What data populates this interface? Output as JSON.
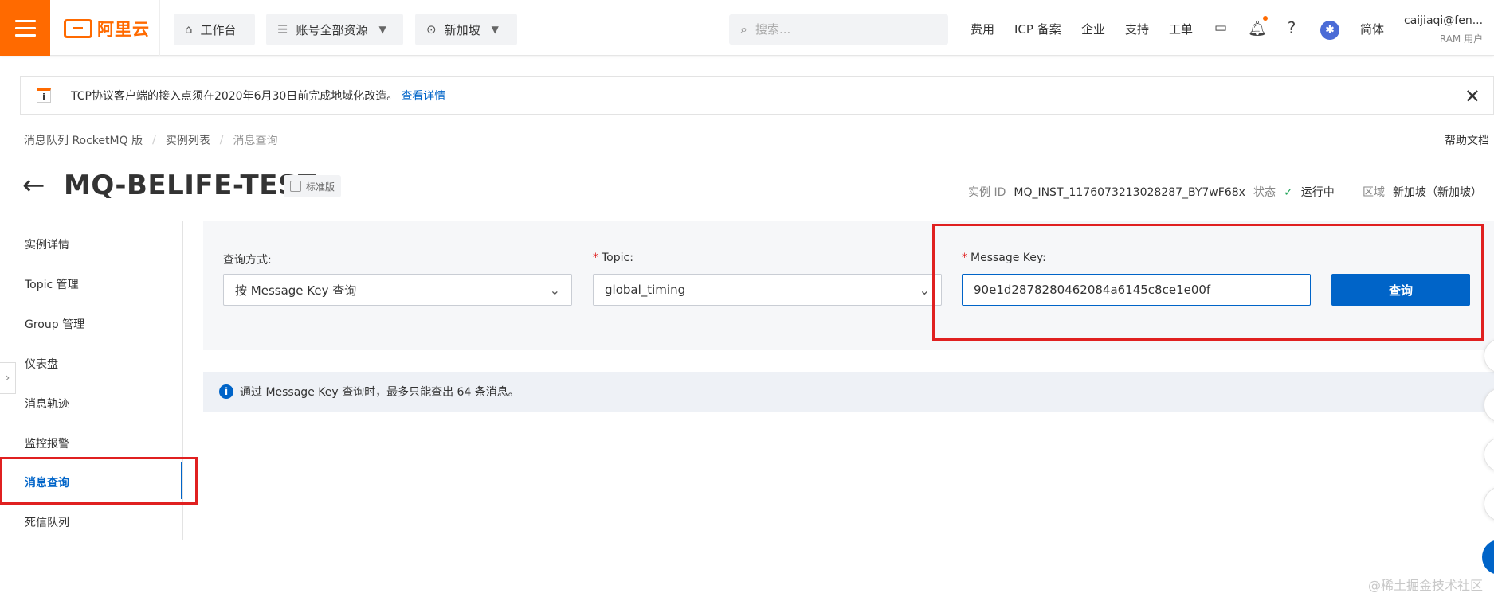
{
  "topbar": {
    "logo_text": "阿里云",
    "workbench": "工作台",
    "resources": "账号全部资源",
    "region": "新加坡",
    "search_placeholder": "搜索...",
    "links": {
      "fees": "费用",
      "icp": "ICP 备案",
      "enterprise": "企业",
      "support": "支持",
      "ticket": "工单",
      "lang": "简体"
    },
    "user": {
      "name": "caijiaqi@fen...",
      "role": "RAM 用户"
    }
  },
  "notice": {
    "icon_letter": "i",
    "text": "TCP协议客户端的接入点须在2020年6月30日前完成地域化改造。",
    "link": "查看详情"
  },
  "breadcrumb": [
    "消息队列 RocketMQ 版",
    "实例列表",
    "消息查询"
  ],
  "help_link": "帮助文档",
  "instance": {
    "name": "MQ-BELIFE-TEST",
    "edition": "标准版",
    "id_label": "实例 ID",
    "id_value": "MQ_INST_1176073213028287_BY7wF68x",
    "status_label": "状态",
    "status_value": "运行中",
    "region_label": "区域",
    "region_value": "新加坡（新加坡）"
  },
  "sidenav": {
    "items": [
      "实例详情",
      "Topic 管理",
      "Group 管理",
      "仪表盘",
      "消息轨迹",
      "监控报警",
      "消息查询",
      "死信队列"
    ],
    "active": "消息查询"
  },
  "query": {
    "method_label": "查询方式:",
    "method_value": "按 Message Key 查询",
    "topic_label": "Topic:",
    "topic_value": "global_timing",
    "key_label": "Message Key:",
    "key_value": "90e1d2878280462084a6145c8ce1e00f",
    "button": "查询"
  },
  "info": {
    "icon_letter": "i",
    "text": "通过 Message Key 查询时，最多只能查出 64 条消息。"
  },
  "watermark": "@稀土掘金技术社区",
  "colors": {
    "brand_orange": "#ff6a00",
    "primary_blue": "#0064c8",
    "highlight_red": "#e02020",
    "status_green": "#22a45b"
  }
}
